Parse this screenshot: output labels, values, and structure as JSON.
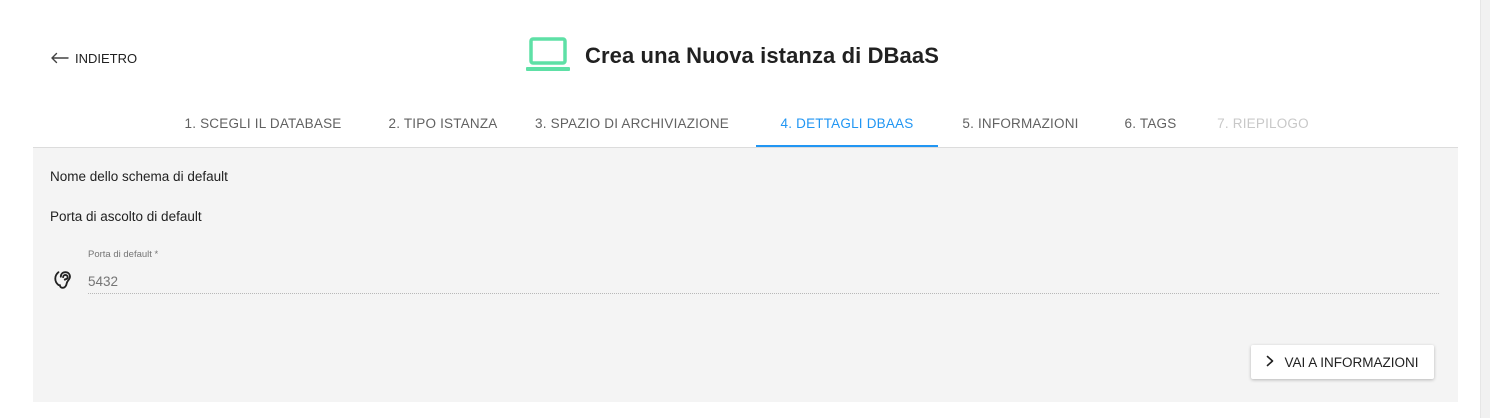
{
  "header": {
    "back_label": "INDIETRO",
    "title": "Crea una Nuova istanza di DBaaS",
    "title_icon": "laptop-icon",
    "accent_color": "#5ee0a6"
  },
  "stepper": {
    "active_color": "#2196f3",
    "steps": [
      {
        "label": "1. SCEGLI IL DATABASE",
        "state": "complete"
      },
      {
        "label": "2. TIPO ISTANZA",
        "state": "complete"
      },
      {
        "label": "3. SPAZIO DI ARCHIVIAZIONE",
        "state": "complete"
      },
      {
        "label": "4. DETTAGLI DBAAS",
        "state": "active"
      },
      {
        "label": "5. INFORMAZIONI",
        "state": "enabled"
      },
      {
        "label": "6. TAGS",
        "state": "enabled"
      },
      {
        "label": "7. RIEPILOGO",
        "state": "disabled"
      }
    ]
  },
  "form": {
    "schema_section_label": "Nome dello schema di default",
    "port_section_label": "Porta di ascolto di default",
    "port_field": {
      "label": "Porta di default *",
      "placeholder": "5432",
      "icon": "ear-icon"
    },
    "next_button_label": "VAI A INFORMAZIONI",
    "next_button_icon": "chevron-right-icon"
  }
}
